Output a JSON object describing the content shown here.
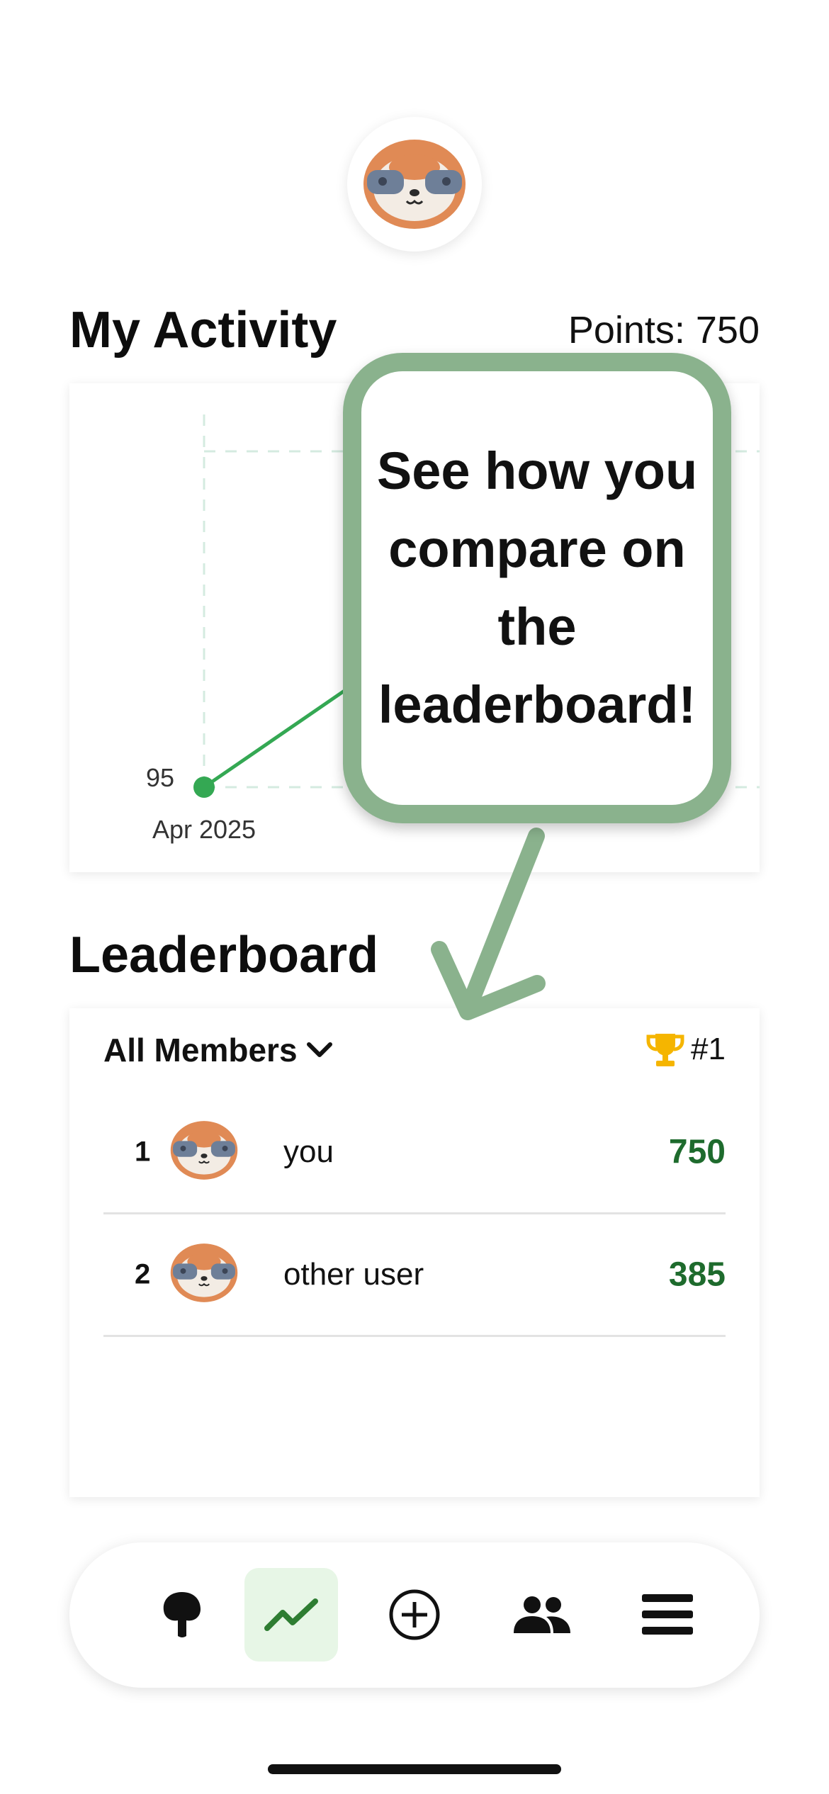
{
  "header": {
    "avatar_icon": "sloth-avatar-icon"
  },
  "activity": {
    "title": "My Activity",
    "points_label": "Points: 750"
  },
  "chart_data": {
    "type": "line",
    "x": [
      "Apr 2025"
    ],
    "series": [
      {
        "values": [
          95
        ]
      }
    ],
    "point_labels": [
      "95"
    ],
    "grid": true,
    "color": "#34a853"
  },
  "tooltip": {
    "text": "See how you compare on the leaderboard!",
    "border_color": "#8ab28d"
  },
  "leaderboard": {
    "title": "Leaderboard",
    "filter_label": "All Members",
    "rank_label": "#1",
    "rows": [
      {
        "rank": "1",
        "name": "you",
        "score": "750"
      },
      {
        "rank": "2",
        "name": "other user",
        "score": "385"
      }
    ],
    "score_color": "#1e6b2d"
  },
  "nav": {
    "items": [
      {
        "icon": "tree-icon",
        "active": false
      },
      {
        "icon": "trending-chart-icon",
        "active": true
      },
      {
        "icon": "add-circle-icon",
        "active": false
      },
      {
        "icon": "people-icon",
        "active": false
      },
      {
        "icon": "menu-icon",
        "active": false
      }
    ],
    "active_color": "#2e7d32"
  }
}
